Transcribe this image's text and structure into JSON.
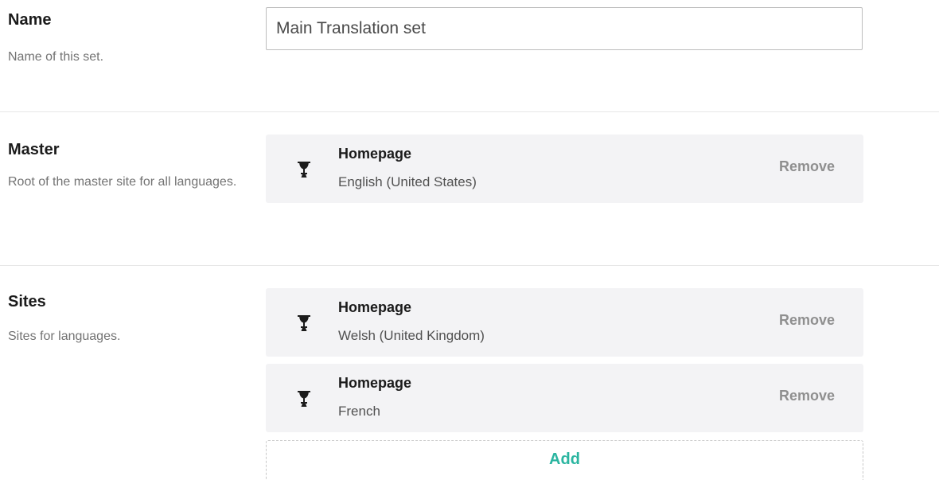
{
  "name_section": {
    "title": "Name",
    "description": "Name of this set.",
    "input_value": "Main Translation set"
  },
  "master_section": {
    "title": "Master",
    "description": "Root of the master site for all languages.",
    "node": {
      "name": "Homepage",
      "detail": "English (United States)",
      "remove_label": "Remove",
      "icon": "trophy-icon"
    }
  },
  "sites_section": {
    "title": "Sites",
    "description": "Sites for languages.",
    "nodes": [
      {
        "name": "Homepage",
        "detail": "Welsh (United Kingdom)",
        "remove_label": "Remove",
        "icon": "trophy-icon"
      },
      {
        "name": "Homepage",
        "detail": "French",
        "remove_label": "Remove",
        "icon": "trophy-icon"
      }
    ],
    "add_label": "Add"
  },
  "colors": {
    "accent": "#2bb5a0",
    "node_background": "#f3f3f5",
    "muted_text": "#737373"
  }
}
